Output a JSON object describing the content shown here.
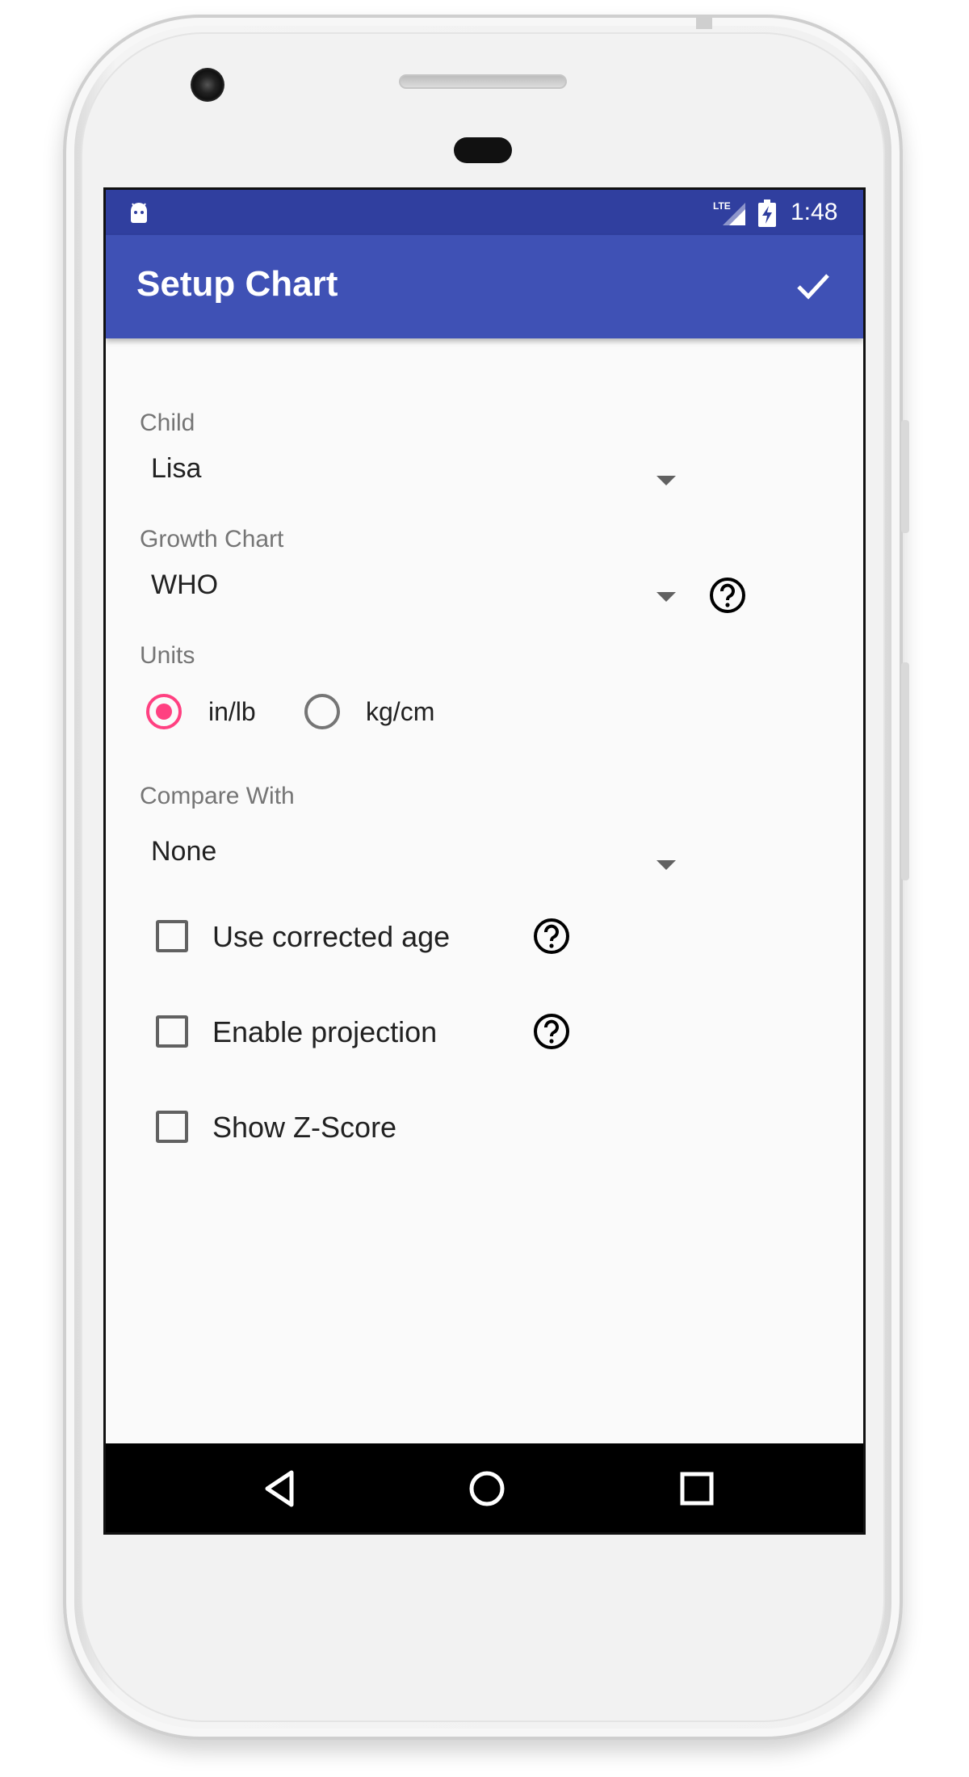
{
  "status_bar": {
    "time": "1:48",
    "network_label": "LTE",
    "icons": [
      "android-debug-icon",
      "lte-signal-icon",
      "battery-charging-icon"
    ]
  },
  "app_bar": {
    "title": "Setup Chart",
    "action_icon": "check-icon"
  },
  "form": {
    "child": {
      "label": "Child",
      "value": "Lisa"
    },
    "growth_chart": {
      "label": "Growth Chart",
      "value": "WHO",
      "help_icon": "help-circle-icon"
    },
    "units": {
      "label": "Units",
      "options": [
        {
          "label": "in/lb",
          "selected": true
        },
        {
          "label": "kg/cm",
          "selected": false
        }
      ]
    },
    "compare_with": {
      "label": "Compare With",
      "value": "None"
    },
    "checkboxes": [
      {
        "label": "Use corrected age",
        "checked": false,
        "has_help": true
      },
      {
        "label": "Enable projection",
        "checked": false,
        "has_help": true
      },
      {
        "label": "Show Z-Score",
        "checked": false,
        "has_help": false
      }
    ]
  },
  "nav_bar": {
    "icons": [
      "back-icon",
      "home-icon",
      "recents-icon"
    ]
  },
  "colors": {
    "status_bar": "#303f9f",
    "app_bar": "#3f51b5",
    "accent": "#ff4081",
    "background": "#fafafa"
  }
}
